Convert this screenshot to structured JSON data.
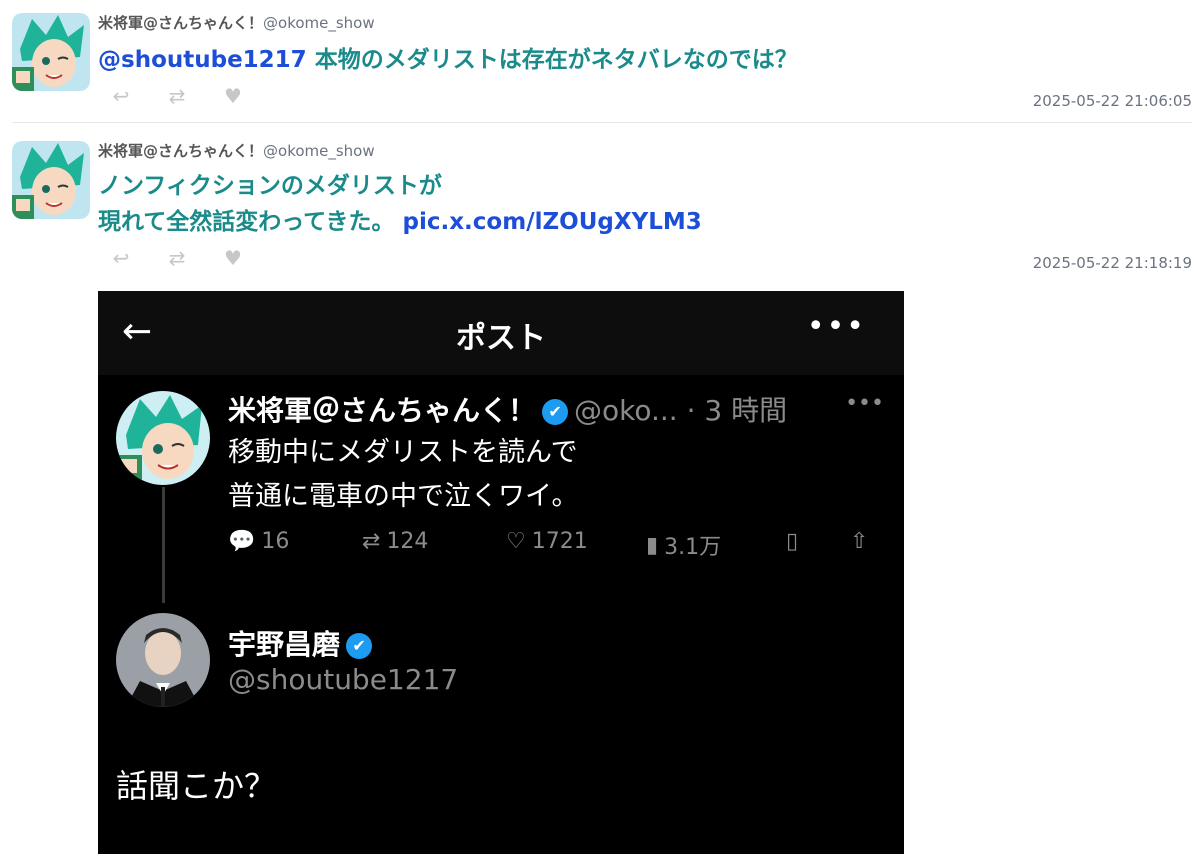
{
  "tweets": [
    {
      "author_name": "米将軍@さんちゃんく！",
      "author_handle": "@okome_show",
      "text_mention": "@shoutube1217",
      "text_body": " 本物のメダリストは存在がネタバレなのでは？",
      "timestamp": "2025-05-22 21:06:05"
    },
    {
      "author_name": "米将軍@さんちゃんく！",
      "author_handle": "@okome_show",
      "text_line1": "ノンフィクションのメダリストが",
      "text_line2": "現れて全然話変わってきた。",
      "link": "pic.x.com/lZOUgXYLM3",
      "timestamp": "2025-05-22 21:18:19"
    }
  ],
  "actions": {
    "reply_icon": "reply-icon",
    "retweet_icon": "retweet-icon",
    "like_icon": "heart-icon"
  },
  "screenshot": {
    "header_title": "ポスト",
    "quoted": {
      "name": "米将軍＠さんちゃんく！",
      "handle_time": "@oko... · 3 時間",
      "line1": "移動中にメダリストを読んで",
      "line2": "普通に電車の中で泣くワイ。",
      "replies": "16",
      "retweets": "124",
      "likes": "1721",
      "views": "3.1万"
    },
    "reply": {
      "name": "宇野昌磨",
      "handle": "@shoutube1217",
      "text": "話聞こか？"
    }
  },
  "colors": {
    "teal_text": "#1a8a8a",
    "link_blue": "#1d4ed8",
    "verified_blue": "#1d9bf0"
  }
}
